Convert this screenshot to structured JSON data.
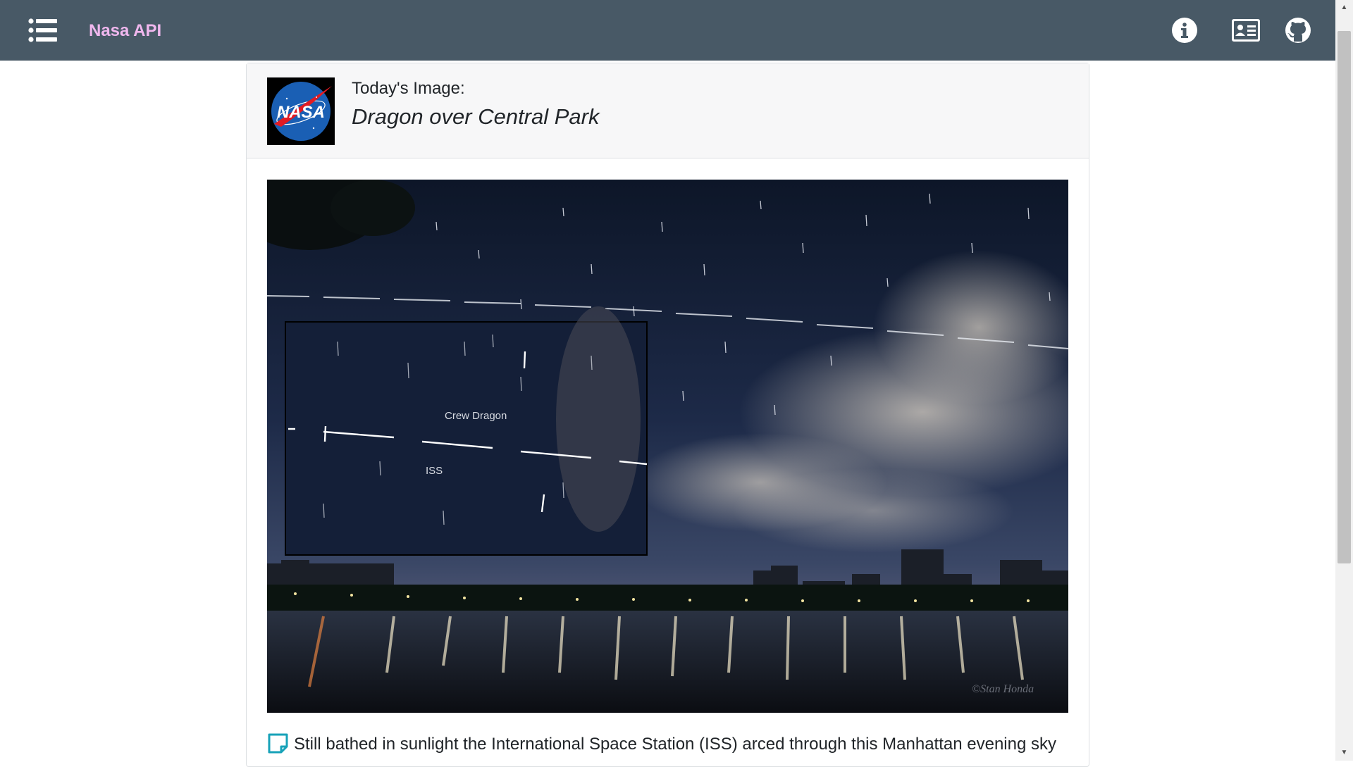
{
  "app": {
    "brand": "Nasa API"
  },
  "navbar": {
    "menu_icon": "list-icon",
    "right_icons": [
      "info-circle-icon",
      "contact-card-icon",
      "github-icon"
    ]
  },
  "apod": {
    "header_label": "Today's Image:",
    "title": "Dragon over Central Park",
    "logo_text": "NASA",
    "inset_labels": {
      "crew_dragon": "Crew Dragon",
      "iss": "ISS"
    },
    "credit": "©Stan Honda",
    "description": "Still bathed in sunlight the International Space Station (ISS) arced through this Manhattan evening sky"
  },
  "colors": {
    "navbar": "#485966",
    "brand": "#f0b7ee",
    "accent": "#17a2b8"
  }
}
